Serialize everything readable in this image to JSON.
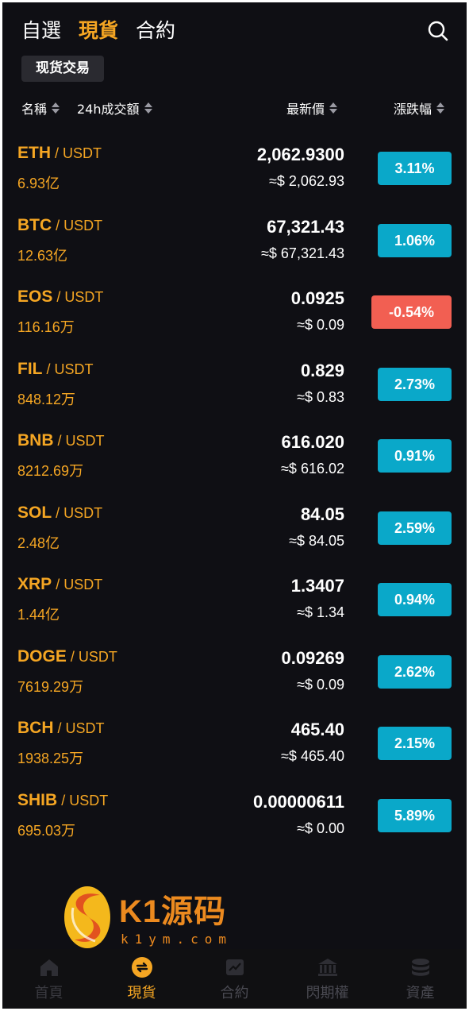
{
  "top_tabs": [
    {
      "label": "自選",
      "active": false
    },
    {
      "label": "現貨",
      "active": true
    },
    {
      "label": "合約",
      "active": false
    }
  ],
  "sub_tab": "现货交易",
  "headers": {
    "name": "名稱",
    "volume": "24h成交額",
    "price": "最新價",
    "change": "漲跌幅"
  },
  "markets": [
    {
      "base": "ETH",
      "quote": "/ USDT",
      "volume": "6.93亿",
      "price": "2,062.9300",
      "usd": "≈$ 2,062.93",
      "change": "3.11%",
      "direction": "up"
    },
    {
      "base": "BTC",
      "quote": "/ USDT",
      "volume": "12.63亿",
      "price": "67,321.43",
      "usd": "≈$ 67,321.43",
      "change": "1.06%",
      "direction": "up"
    },
    {
      "base": "EOS",
      "quote": "/ USDT",
      "volume": "116.16万",
      "price": "0.0925",
      "usd": "≈$ 0.09",
      "change": "-0.54%",
      "direction": "down"
    },
    {
      "base": "FIL",
      "quote": "/ USDT",
      "volume": "848.12万",
      "price": "0.829",
      "usd": "≈$ 0.83",
      "change": "2.73%",
      "direction": "up"
    },
    {
      "base": "BNB",
      "quote": "/ USDT",
      "volume": "8212.69万",
      "price": "616.020",
      "usd": "≈$ 616.02",
      "change": "0.91%",
      "direction": "up"
    },
    {
      "base": "SOL",
      "quote": "/ USDT",
      "volume": "2.48亿",
      "price": "84.05",
      "usd": "≈$ 84.05",
      "change": "2.59%",
      "direction": "up"
    },
    {
      "base": "XRP",
      "quote": "/ USDT",
      "volume": "1.44亿",
      "price": "1.3407",
      "usd": "≈$ 1.34",
      "change": "0.94%",
      "direction": "up"
    },
    {
      "base": "DOGE",
      "quote": "/ USDT",
      "volume": "7619.29万",
      "price": "0.09269",
      "usd": "≈$ 0.09",
      "change": "2.62%",
      "direction": "up"
    },
    {
      "base": "BCH",
      "quote": "/ USDT",
      "volume": "1938.25万",
      "price": "465.40",
      "usd": "≈$ 465.40",
      "change": "2.15%",
      "direction": "up"
    },
    {
      "base": "SHIB",
      "quote": "/ USDT",
      "volume": "695.03万",
      "price": "0.00000611",
      "usd": "≈$ 0.00",
      "change": "5.89%",
      "direction": "up"
    }
  ],
  "watermark": {
    "brand": "K1源码",
    "url": "k1ym.com"
  },
  "bottom_nav": [
    {
      "label": "首頁",
      "icon": "home-icon",
      "active": false
    },
    {
      "label": "現貨",
      "icon": "exchange-icon",
      "active": true
    },
    {
      "label": "合約",
      "icon": "chart-icon",
      "active": false
    },
    {
      "label": "閃期權",
      "icon": "bank-icon",
      "active": false
    },
    {
      "label": "資產",
      "icon": "coins-icon",
      "active": false
    }
  ],
  "colors": {
    "background": "#0f0f14",
    "accent": "#f5a623",
    "up": "#0aa8c9",
    "down": "#f25f52"
  }
}
